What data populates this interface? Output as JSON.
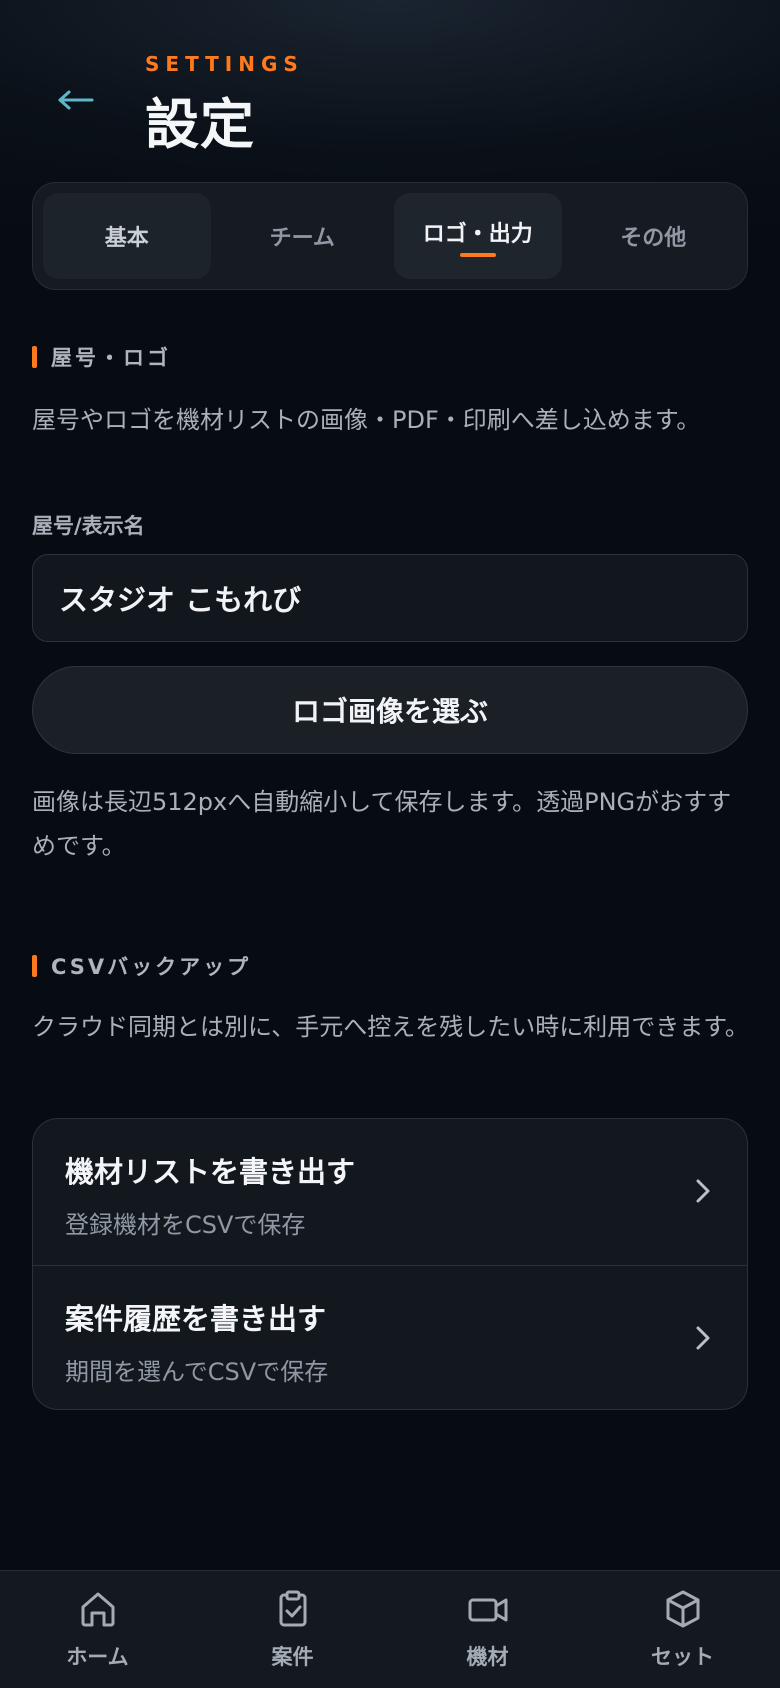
{
  "header": {
    "back_icon": "arrow-left-icon",
    "eyebrow": "SETTINGS",
    "title": "設定",
    "back_color": "#5fb8c9"
  },
  "tabs": [
    {
      "label": "基本",
      "active": false
    },
    {
      "label": "チーム",
      "active": false
    },
    {
      "label": "ロゴ・出力",
      "active": true
    },
    {
      "label": "その他",
      "active": false
    }
  ],
  "accent_color": "#ff7a1f",
  "logo_section": {
    "title": "屋号・ロゴ",
    "description": "屋号やロゴを機材リストの画像・PDF・印刷へ差し込めます。",
    "field_label": "屋号/表示名",
    "field_value": "スタジオ こもれび",
    "choose_button": "ロゴ画像を選ぶ",
    "note": "画像は長辺512pxへ自動縮小して保存します。透過PNGがおすすめです。"
  },
  "csv_section": {
    "title": "CSVバックアップ",
    "description": "クラウド同期とは別に、手元へ控えを残したい時に利用できます。",
    "items": [
      {
        "title": "機材リストを書き出す",
        "subtitle": "登録機材をCSVで保存",
        "icon": "chevron-right-icon"
      },
      {
        "title": "案件履歴を書き出す",
        "subtitle": "期間を選んでCSVで保存",
        "icon": "chevron-right-icon"
      }
    ]
  },
  "bottom_nav": [
    {
      "label": "ホーム",
      "icon": "home-icon"
    },
    {
      "label": "案件",
      "icon": "clipboard-check-icon"
    },
    {
      "label": "機材",
      "icon": "video-camera-icon"
    },
    {
      "label": "セット",
      "icon": "box-icon"
    }
  ]
}
